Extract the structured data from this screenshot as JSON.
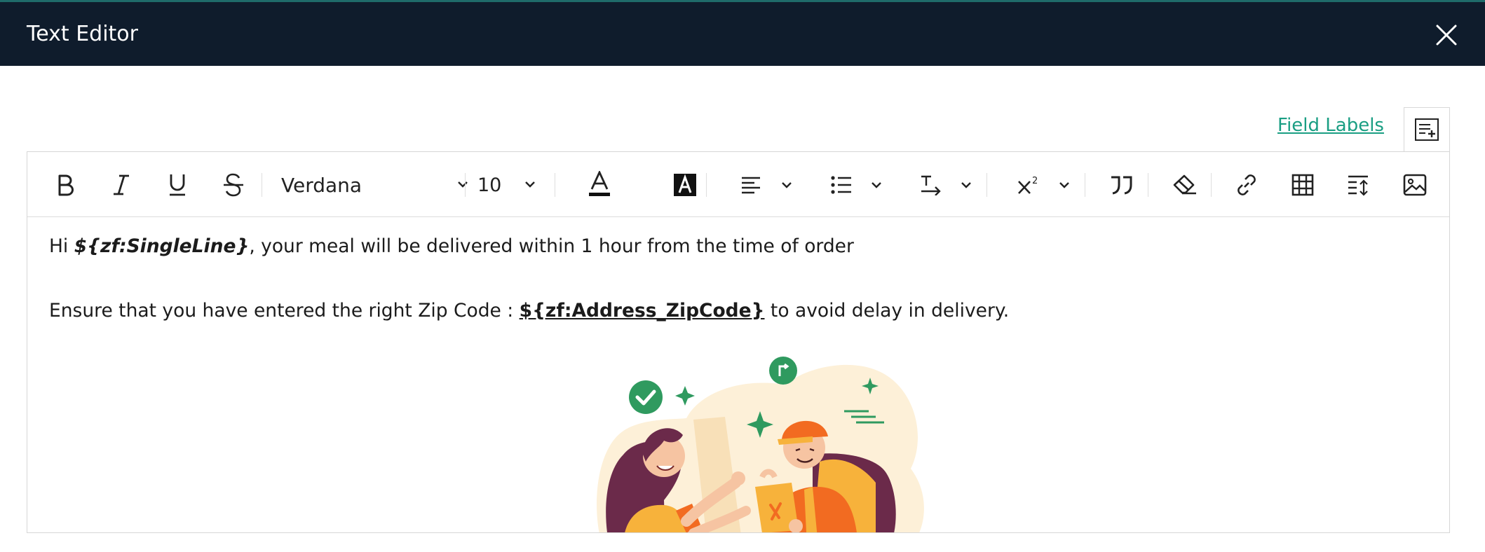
{
  "window": {
    "title": "Text Editor"
  },
  "field_labels": {
    "link_text": "Field Labels"
  },
  "toolbar": {
    "font_family": "Verdana",
    "font_size": "10",
    "buttons": [
      "bold",
      "italic",
      "underline",
      "strikethrough",
      "text-color",
      "highlight-color",
      "align",
      "list",
      "text-direction",
      "superscript",
      "blockquote",
      "clear-format",
      "link",
      "table",
      "line-spacing",
      "image"
    ]
  },
  "content": {
    "line1": {
      "prefix": "Hi ",
      "merge_field": "${zf:SingleLine}",
      "suffix": ", your meal will be delivered within 1 hour from the time of order"
    },
    "line2": {
      "prefix": "Ensure that you have entered the right Zip Code : ",
      "merge_field": "${zf:Address_ZipCode}",
      "suffix": " to avoid delay in delivery."
    },
    "image": "food-delivery-illustration"
  },
  "colors": {
    "topbar": "#0f1c2c",
    "accent": "#1a9e83",
    "illustration_orange": "#f26b21",
    "illustration_green": "#2f9a5f"
  }
}
